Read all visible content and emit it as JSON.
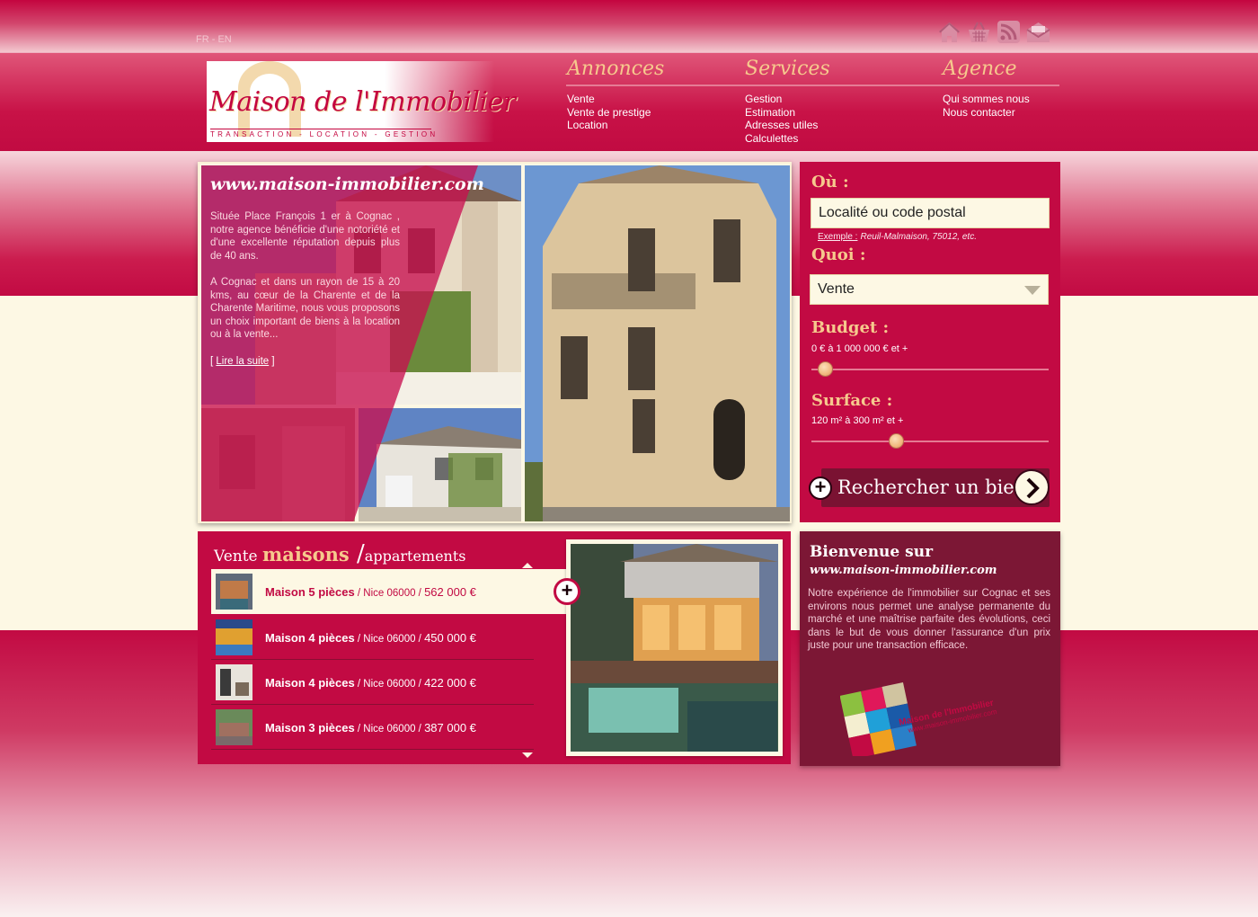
{
  "top": {
    "lang_fr": "FR",
    "lang_sep": " - ",
    "lang_en": "EN",
    "icons": [
      "home-icon",
      "basket-icon",
      "rss-icon",
      "mail-icon"
    ]
  },
  "logo": {
    "text": "Maison de l'Immobilier",
    "subtitle": "TRANSACTION - LOCATION - GESTION"
  },
  "nav": {
    "annonces": {
      "title": "Annonces",
      "links": [
        "Vente",
        "Vente de prestige",
        "Location"
      ]
    },
    "services": {
      "title": "Services",
      "links": [
        "Gestion",
        "Estimation",
        "Adresses utiles",
        "Calculettes"
      ]
    },
    "agence": {
      "title": "Agence",
      "links": [
        "Qui sommes nous",
        "Nous contacter"
      ]
    }
  },
  "hero": {
    "title": "www.maison-immobilier.com",
    "p1": "Située Place François 1 er à Cognac , notre agence bénéficie d'une notoriété et d'une excellente réputation depuis plus de 40 ans.",
    "p2": "A Cognac et dans un rayon de 15 à 20 kms, au cœur de la Charente et de la Charente Maritime, nous vous proposons un choix important de biens à la location ou à la vente...",
    "more_open": "[ ",
    "more_link": "Lire la suite",
    "more_close": " ]"
  },
  "search": {
    "where_label": "Où :",
    "where_placeholder": "Localité ou code postal",
    "hint_label": "Exemple :",
    "hint_text": "Reuil-Malmaison, 75012, etc.",
    "what_label": "Quoi :",
    "what_value": "Vente",
    "budget_label": "Budget :",
    "budget_range": "0 € à 1 000 000 € et +",
    "budget_position": 0.03,
    "surface_label": "Surface :",
    "surface_range": "120 m² à 300 m² et +",
    "surface_position": 0.35,
    "button": "Rechercher un bien",
    "button_plus": "+"
  },
  "listings": {
    "title_a": "Vente ",
    "title_b": "maisons",
    "title_slash": " /",
    "title_c": "appartements",
    "plus": "+",
    "items": [
      {
        "name": "Maison 5 pièces",
        "loc": " / Nice 06000 / ",
        "price": "562 000 €"
      },
      {
        "name": "Maison 4 pièces",
        "loc": " / Nice 06000 / ",
        "price": "450 000 €"
      },
      {
        "name": "Maison 4 pièces",
        "loc": " / Nice 06000 / ",
        "price": "422 000 €"
      },
      {
        "name": "Maison 3 pièces",
        "loc": " / Nice 06000 / ",
        "price": "387 000 €"
      }
    ]
  },
  "welcome": {
    "title": "Bienvenue sur",
    "url": "www.maison-immobilier.com",
    "text": "Notre expérience de l'immobilier sur Cognac et ses environs nous permet une analyse permanente du marché et une maîtrise parfaite des évolutions, ceci dans le but de vous donner l'assurance d'un prix juste pour une transaction efficace.",
    "logo_text": "Maison de l'Immobilier",
    "logo_url": "www.maison-immobilier.com"
  },
  "colors": {
    "primary": "#c20a43",
    "dark": "#7c1735",
    "gold": "#f6c98d",
    "cream": "#fdf8e4"
  }
}
